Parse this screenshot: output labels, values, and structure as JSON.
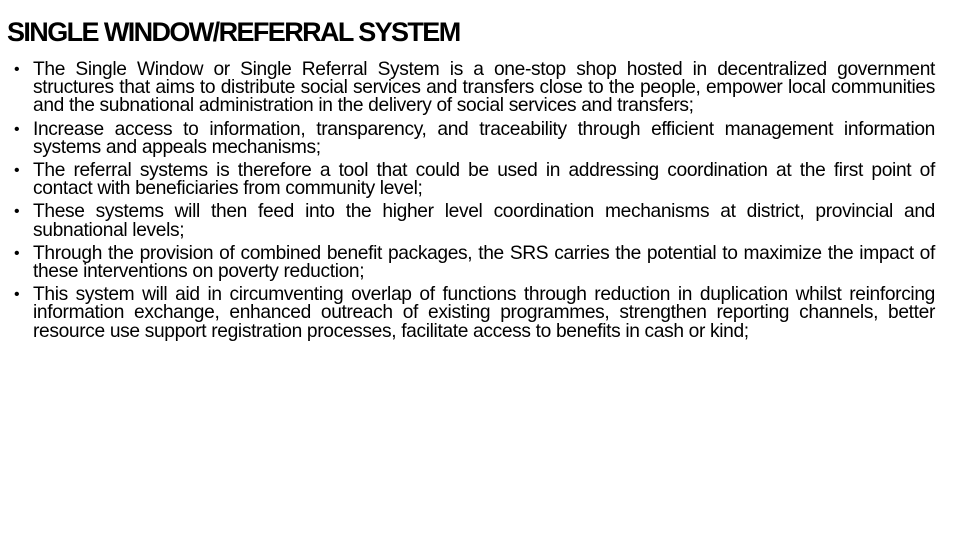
{
  "slide": {
    "title": "SINGLE WINDOW/REFERRAL SYSTEM",
    "bullet_symbol": "•",
    "bullets": [
      {
        "text": "The Single Window or Single Referral System is a one-stop shop hosted in decentralized government structures that aims to distribute social services and transfers close to the people, empower local communities and the subnational administration in the delivery of social services and transfers;"
      },
      {
        "text": "Increase access to information, transparency, and traceability through efficient management information systems and appeals mechanisms;"
      },
      {
        "text": "The referral systems is therefore a tool that could be used in addressing coordination at the first point of contact with beneficiaries from community level;"
      },
      {
        "text": "These systems will then feed into the higher level coordination mechanisms at district, provincial and subnational levels;"
      },
      {
        "text": "Through the provision of combined benefit packages, the SRS carries the potential to maximize the impact of these interventions on poverty reduction;"
      },
      {
        "text": "This system will aid in circumventing overlap of functions through reduction in duplication whilst reinforcing information exchange, enhanced outreach of existing programmes, strengthen reporting channels, better resource use support registration processes, facilitate access to benefits in cash or kind;"
      }
    ]
  }
}
